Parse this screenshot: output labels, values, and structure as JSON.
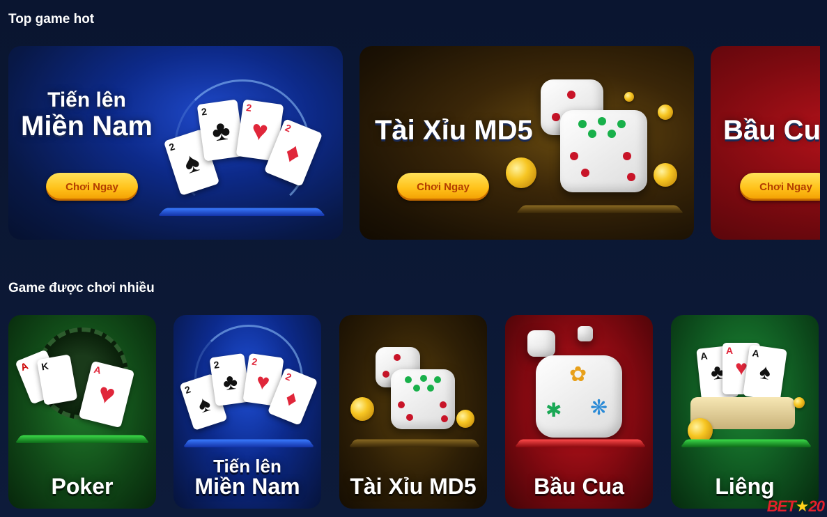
{
  "sections": {
    "hot_title": "Top game hot",
    "popular_title": "Game được chơi nhiều"
  },
  "hot_games": [
    {
      "line1": "Tiến lên",
      "line2": "Miền Nam",
      "button": "Chơi Ngay"
    },
    {
      "line1": "",
      "line2": "Tài Xỉu MD5",
      "button": "Chơi Ngay"
    },
    {
      "line1": "",
      "line2": "Bầu Cu",
      "button": "Chơi Ngay"
    }
  ],
  "popular_games": [
    {
      "line1": "",
      "line2": "Poker"
    },
    {
      "line1": "Tiến lên",
      "line2": "Miền Nam"
    },
    {
      "line1": "",
      "line2": "Tài Xỉu MD5"
    },
    {
      "line1": "",
      "line2": "Bầu Cua"
    },
    {
      "line1": "",
      "line2": "Liêng"
    }
  ],
  "watermark": {
    "text": "BET",
    "star": "★",
    "num": "20"
  },
  "colors": {
    "background": "#0b1733",
    "button": "#ffc21a",
    "button_text": "#b33d00"
  }
}
